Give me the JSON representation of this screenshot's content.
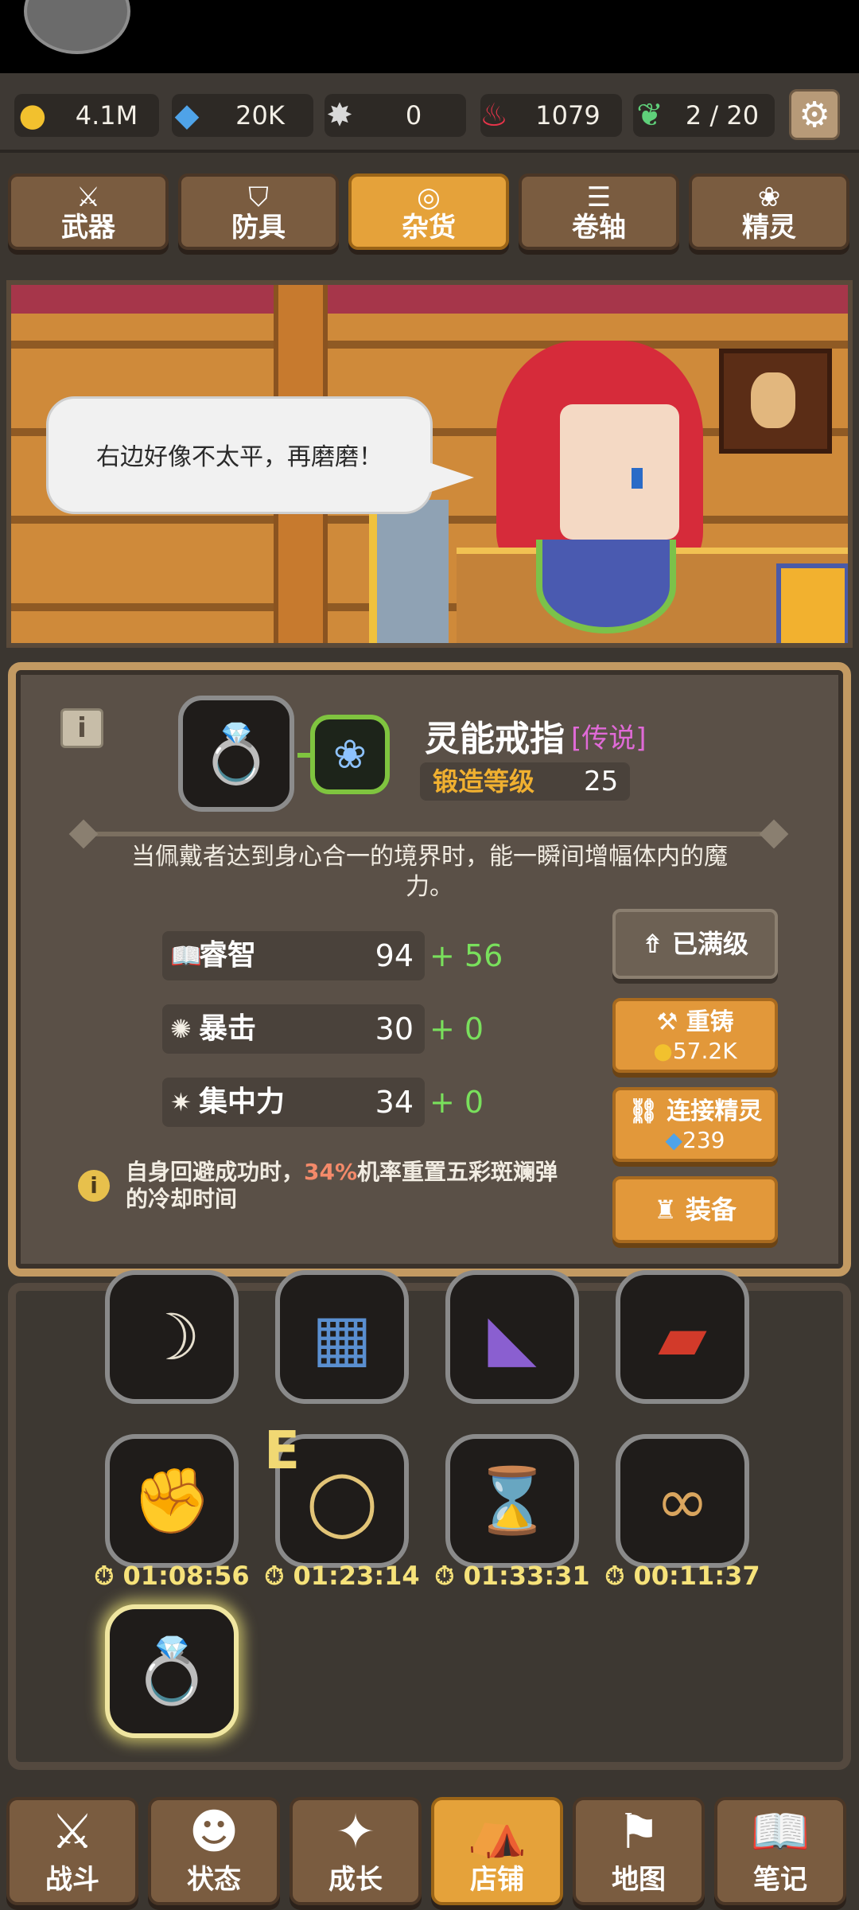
{
  "resources": [
    {
      "icon": "gold-coin-icon",
      "glyph": "●",
      "color": "#f2c12e",
      "value": "4.1M"
    },
    {
      "icon": "blue-gem-icon",
      "glyph": "◆",
      "color": "#4fa3e8",
      "value": "20K"
    },
    {
      "icon": "spark-icon",
      "glyph": "✸",
      "color": "#d9d9d9",
      "value": "0"
    },
    {
      "icon": "red-flame-icon",
      "glyph": "♨",
      "color": "#e8344a",
      "value": "1079"
    },
    {
      "icon": "green-leaf-icon",
      "glyph": "❦",
      "color": "#5fd07a",
      "value": "2 / 20"
    }
  ],
  "categories": [
    {
      "label": "武器",
      "icon": "sword-icon",
      "glyph": "⚔",
      "active": false
    },
    {
      "label": "防具",
      "icon": "shield-icon",
      "glyph": "⛉",
      "active": false
    },
    {
      "label": "杂货",
      "icon": "ring-icon",
      "glyph": "◎",
      "active": true
    },
    {
      "label": "卷轴",
      "icon": "scroll-icon",
      "glyph": "☰",
      "active": false
    },
    {
      "label": "精灵",
      "icon": "fairy-icon",
      "glyph": "❀",
      "active": false
    }
  ],
  "scene": {
    "speech": "右边好像不太平，再磨磨！"
  },
  "item": {
    "name": "灵能戒指",
    "rarity": "[传说]",
    "forge_label": "锻造等级",
    "forge_level": "25",
    "description": "当佩戴者达到身心合一的境界时，能一瞬间增幅体内的魔力。",
    "stats": [
      {
        "icon": "book-icon",
        "glyph": "📖",
        "name": "睿智",
        "value": "94",
        "bonus": "+ 56"
      },
      {
        "icon": "crit-icon",
        "glyph": "✺",
        "name": "暴击",
        "value": "30",
        "bonus": "+ 0"
      },
      {
        "icon": "focus-icon",
        "glyph": "✷",
        "name": "集中力",
        "value": "34",
        "bonus": "+ 0"
      }
    ],
    "passive_pre": "自身回避成功时，",
    "passive_hl": "34%",
    "passive_post": "机率重置五彩斑斓弹的冷却时间"
  },
  "actions": {
    "maxed": "已满级",
    "reforge": "重铸",
    "reforge_cost": "57.2K",
    "link": "连接精灵",
    "link_cost": "239",
    "equip": "装备"
  },
  "inventory": {
    "e_label": "E",
    "timers": [
      "01:08:56",
      "01:23:14",
      "01:33:31",
      "00:11:37"
    ]
  },
  "nav": [
    {
      "label": "战斗",
      "icon": "battle-icon",
      "glyph": "⚔",
      "active": false
    },
    {
      "label": "状态",
      "icon": "person-icon",
      "glyph": "👤",
      "active": false
    },
    {
      "label": "成长",
      "icon": "star-icon",
      "glyph": "✦",
      "active": false
    },
    {
      "label": "店铺",
      "icon": "tent-icon",
      "glyph": "⛺",
      "active": true
    },
    {
      "label": "地图",
      "icon": "signpost-icon",
      "glyph": "⚑",
      "active": false
    },
    {
      "label": "笔记",
      "icon": "book-icon",
      "glyph": "📖",
      "active": false
    }
  ]
}
